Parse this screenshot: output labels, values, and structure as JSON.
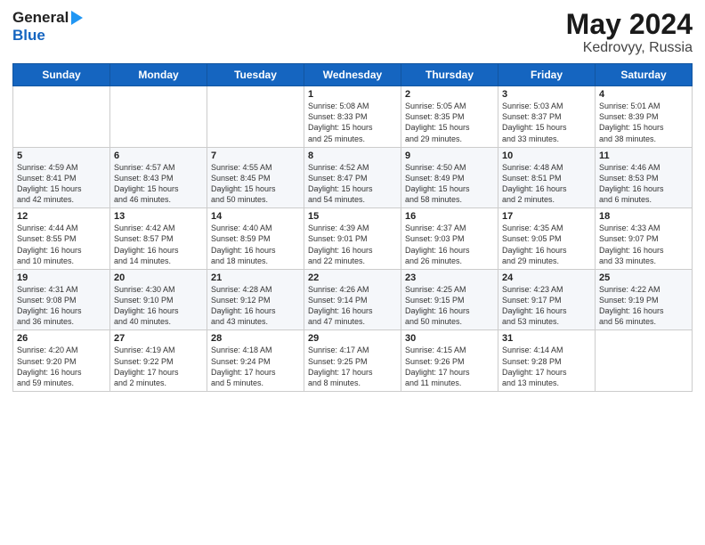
{
  "header": {
    "logo_general": "General",
    "logo_blue": "Blue",
    "title": "May 2024",
    "subtitle": "Kedrovyy, Russia"
  },
  "calendar": {
    "days_of_week": [
      "Sunday",
      "Monday",
      "Tuesday",
      "Wednesday",
      "Thursday",
      "Friday",
      "Saturday"
    ],
    "weeks": [
      [
        {
          "day": "",
          "info": ""
        },
        {
          "day": "",
          "info": ""
        },
        {
          "day": "",
          "info": ""
        },
        {
          "day": "1",
          "info": "Sunrise: 5:08 AM\nSunset: 8:33 PM\nDaylight: 15 hours\nand 25 minutes."
        },
        {
          "day": "2",
          "info": "Sunrise: 5:05 AM\nSunset: 8:35 PM\nDaylight: 15 hours\nand 29 minutes."
        },
        {
          "day": "3",
          "info": "Sunrise: 5:03 AM\nSunset: 8:37 PM\nDaylight: 15 hours\nand 33 minutes."
        },
        {
          "day": "4",
          "info": "Sunrise: 5:01 AM\nSunset: 8:39 PM\nDaylight: 15 hours\nand 38 minutes."
        }
      ],
      [
        {
          "day": "5",
          "info": "Sunrise: 4:59 AM\nSunset: 8:41 PM\nDaylight: 15 hours\nand 42 minutes."
        },
        {
          "day": "6",
          "info": "Sunrise: 4:57 AM\nSunset: 8:43 PM\nDaylight: 15 hours\nand 46 minutes."
        },
        {
          "day": "7",
          "info": "Sunrise: 4:55 AM\nSunset: 8:45 PM\nDaylight: 15 hours\nand 50 minutes."
        },
        {
          "day": "8",
          "info": "Sunrise: 4:52 AM\nSunset: 8:47 PM\nDaylight: 15 hours\nand 54 minutes."
        },
        {
          "day": "9",
          "info": "Sunrise: 4:50 AM\nSunset: 8:49 PM\nDaylight: 15 hours\nand 58 minutes."
        },
        {
          "day": "10",
          "info": "Sunrise: 4:48 AM\nSunset: 8:51 PM\nDaylight: 16 hours\nand 2 minutes."
        },
        {
          "day": "11",
          "info": "Sunrise: 4:46 AM\nSunset: 8:53 PM\nDaylight: 16 hours\nand 6 minutes."
        }
      ],
      [
        {
          "day": "12",
          "info": "Sunrise: 4:44 AM\nSunset: 8:55 PM\nDaylight: 16 hours\nand 10 minutes."
        },
        {
          "day": "13",
          "info": "Sunrise: 4:42 AM\nSunset: 8:57 PM\nDaylight: 16 hours\nand 14 minutes."
        },
        {
          "day": "14",
          "info": "Sunrise: 4:40 AM\nSunset: 8:59 PM\nDaylight: 16 hours\nand 18 minutes."
        },
        {
          "day": "15",
          "info": "Sunrise: 4:39 AM\nSunset: 9:01 PM\nDaylight: 16 hours\nand 22 minutes."
        },
        {
          "day": "16",
          "info": "Sunrise: 4:37 AM\nSunset: 9:03 PM\nDaylight: 16 hours\nand 26 minutes."
        },
        {
          "day": "17",
          "info": "Sunrise: 4:35 AM\nSunset: 9:05 PM\nDaylight: 16 hours\nand 29 minutes."
        },
        {
          "day": "18",
          "info": "Sunrise: 4:33 AM\nSunset: 9:07 PM\nDaylight: 16 hours\nand 33 minutes."
        }
      ],
      [
        {
          "day": "19",
          "info": "Sunrise: 4:31 AM\nSunset: 9:08 PM\nDaylight: 16 hours\nand 36 minutes."
        },
        {
          "day": "20",
          "info": "Sunrise: 4:30 AM\nSunset: 9:10 PM\nDaylight: 16 hours\nand 40 minutes."
        },
        {
          "day": "21",
          "info": "Sunrise: 4:28 AM\nSunset: 9:12 PM\nDaylight: 16 hours\nand 43 minutes."
        },
        {
          "day": "22",
          "info": "Sunrise: 4:26 AM\nSunset: 9:14 PM\nDaylight: 16 hours\nand 47 minutes."
        },
        {
          "day": "23",
          "info": "Sunrise: 4:25 AM\nSunset: 9:15 PM\nDaylight: 16 hours\nand 50 minutes."
        },
        {
          "day": "24",
          "info": "Sunrise: 4:23 AM\nSunset: 9:17 PM\nDaylight: 16 hours\nand 53 minutes."
        },
        {
          "day": "25",
          "info": "Sunrise: 4:22 AM\nSunset: 9:19 PM\nDaylight: 16 hours\nand 56 minutes."
        }
      ],
      [
        {
          "day": "26",
          "info": "Sunrise: 4:20 AM\nSunset: 9:20 PM\nDaylight: 16 hours\nand 59 minutes."
        },
        {
          "day": "27",
          "info": "Sunrise: 4:19 AM\nSunset: 9:22 PM\nDaylight: 17 hours\nand 2 minutes."
        },
        {
          "day": "28",
          "info": "Sunrise: 4:18 AM\nSunset: 9:24 PM\nDaylight: 17 hours\nand 5 minutes."
        },
        {
          "day": "29",
          "info": "Sunrise: 4:17 AM\nSunset: 9:25 PM\nDaylight: 17 hours\nand 8 minutes."
        },
        {
          "day": "30",
          "info": "Sunrise: 4:15 AM\nSunset: 9:26 PM\nDaylight: 17 hours\nand 11 minutes."
        },
        {
          "day": "31",
          "info": "Sunrise: 4:14 AM\nSunset: 9:28 PM\nDaylight: 17 hours\nand 13 minutes."
        },
        {
          "day": "",
          "info": ""
        }
      ]
    ]
  }
}
